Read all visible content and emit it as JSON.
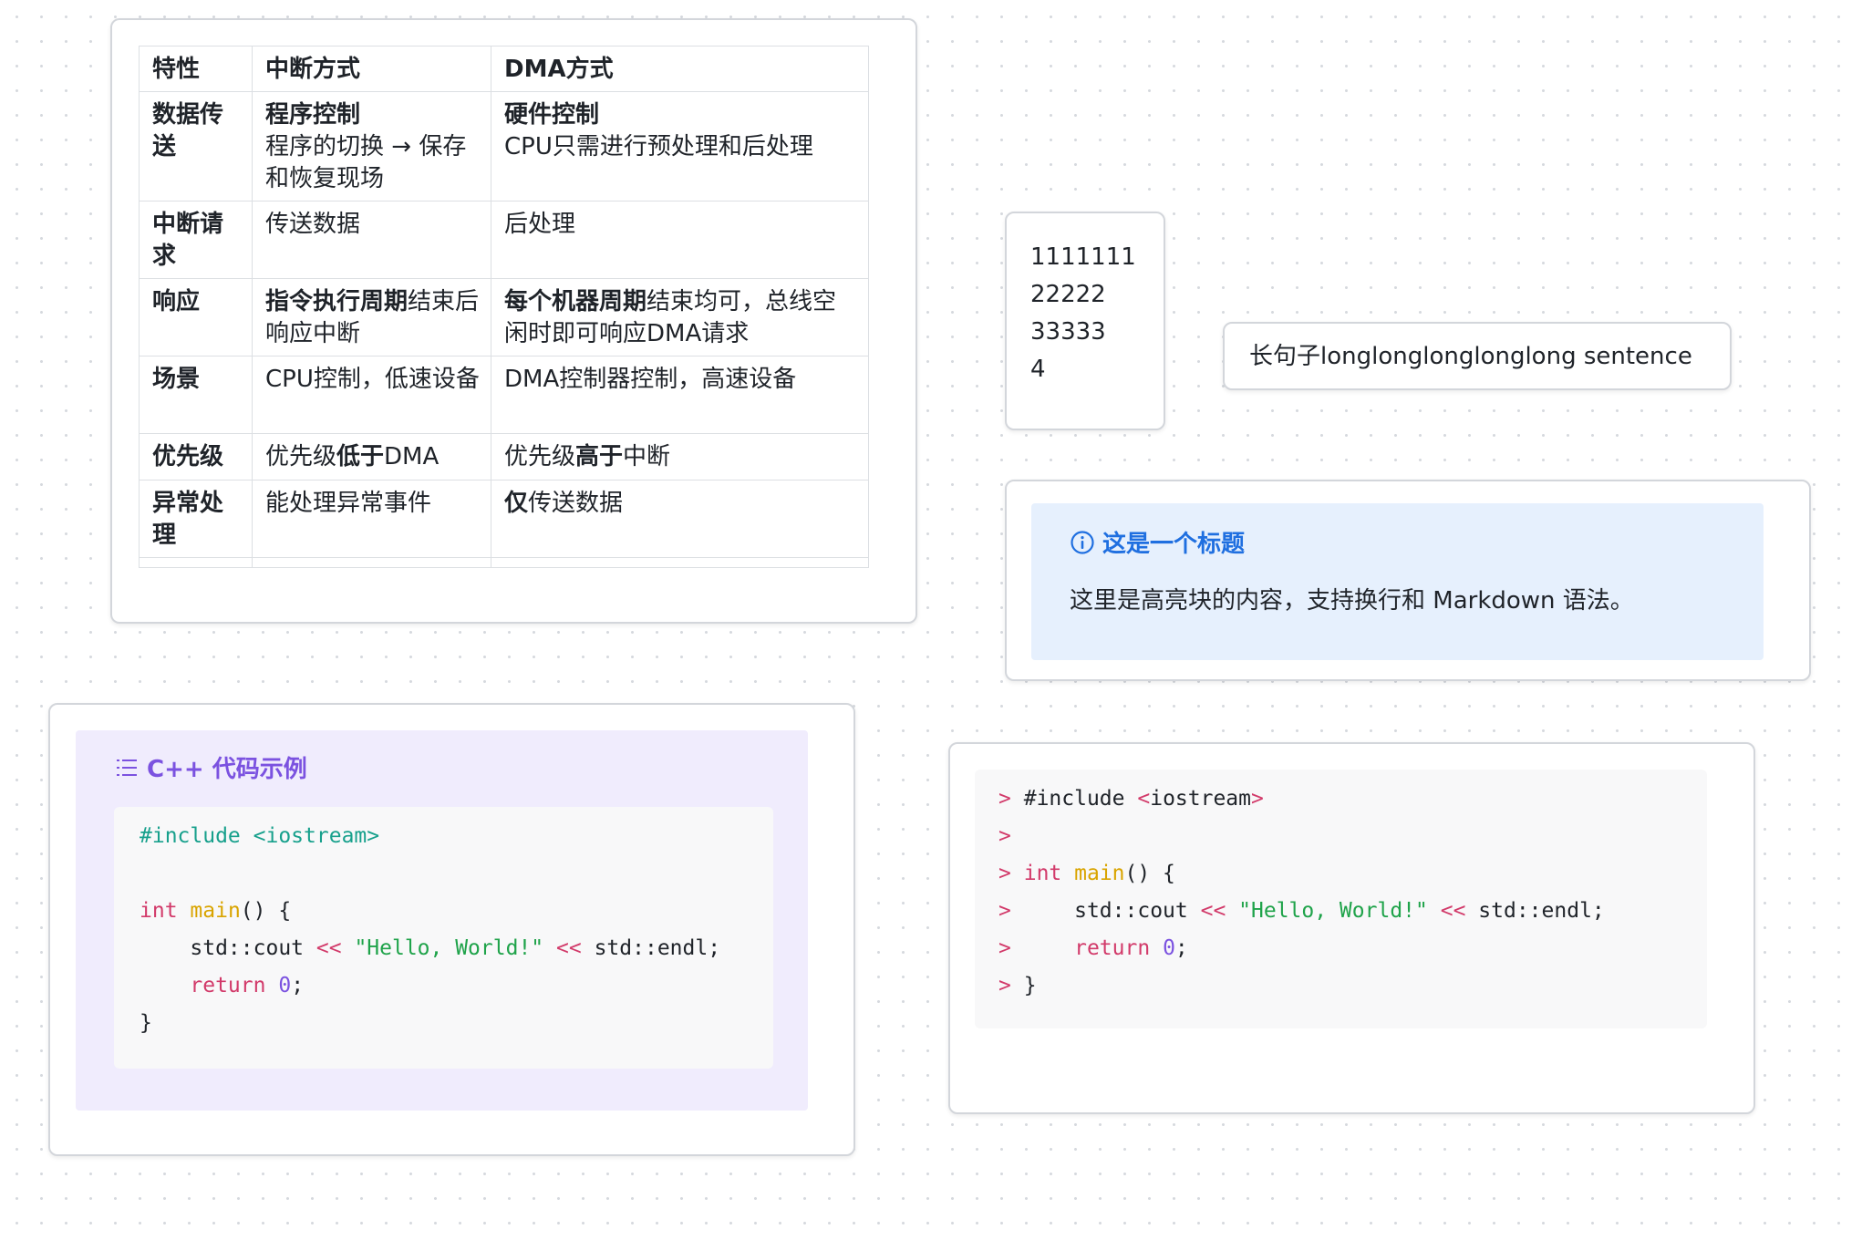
{
  "table": {
    "headers": [
      "特性",
      "中断方式",
      "DMA方式"
    ],
    "rows": [
      {
        "feature": "数据传送",
        "interrupt_bold": "程序控制",
        "interrupt_text": "程序的切换 → 保存和恢复现场",
        "dma_bold": "硬件控制",
        "dma_text": "CPU只需进行预处理和后处理"
      },
      {
        "feature": "中断请求",
        "interrupt_text": "传送数据",
        "dma_text": "后处理"
      },
      {
        "feature": "响应",
        "interrupt_bold": "指令执行周期",
        "interrupt_text": "结束后响应中断",
        "dma_bold": "每个机器周期",
        "dma_text": "结束均可，总线空闲时即可响应DMA请求"
      },
      {
        "feature": "场景",
        "interrupt_text": "CPU控制，低速设备",
        "dma_text": "DMA控制器控制，高速设备"
      },
      {
        "feature": "优先级",
        "interrupt_prefix": "优先级",
        "interrupt_bold": "低于",
        "interrupt_suffix": "DMA",
        "dma_prefix": "优先级",
        "dma_bold": "高于",
        "dma_suffix": "中断"
      },
      {
        "feature": "异常处理",
        "interrupt_text": "能处理异常事件",
        "dma_bold": "仅",
        "dma_text": "传送数据"
      }
    ]
  },
  "numbers_card": {
    "lines": [
      "1111111",
      "22222",
      "33333",
      "4"
    ]
  },
  "sentence_card": {
    "text": "长句子longlonglonglonglong sentence"
  },
  "highlight_card": {
    "title": "这是一个标题",
    "icon": "info-circle-icon",
    "body": "这里是高亮块的内容，支持换行和 Markdown 语法。",
    "accent_color": "#1f6fe0",
    "background": "#e6f0fd"
  },
  "cpp_card": {
    "title": "C++ 代码示例",
    "icon": "list-icon",
    "accent_color": "#7b52e0",
    "background": "#f0ecfd",
    "code": {
      "include_directive": "#include",
      "include_header": "<iostream>",
      "kw_int": "int",
      "fn_main": "main",
      "paren_open": "() {",
      "cout": "std::cout",
      "op_shift": "<<",
      "string": "\"Hello, World!\"",
      "endl": "std::endl;",
      "kw_return": "return",
      "num_zero": "0",
      "semicolon": ";",
      "close_brace": "}"
    }
  },
  "quote_card": {
    "quote_marker": ">",
    "code": {
      "include": "#include",
      "lt": "<",
      "header_name": "iostream",
      "gt": ">",
      "kw_int": "int",
      "fn_main": "main",
      "paren_open": "() {",
      "cout": "std::cout",
      "op_shift": "<<",
      "string": "\"Hello, World!\"",
      "endl": "std::endl;",
      "kw_return": "return",
      "num_zero": "0",
      "semicolon": ";",
      "close_brace": "}"
    }
  }
}
